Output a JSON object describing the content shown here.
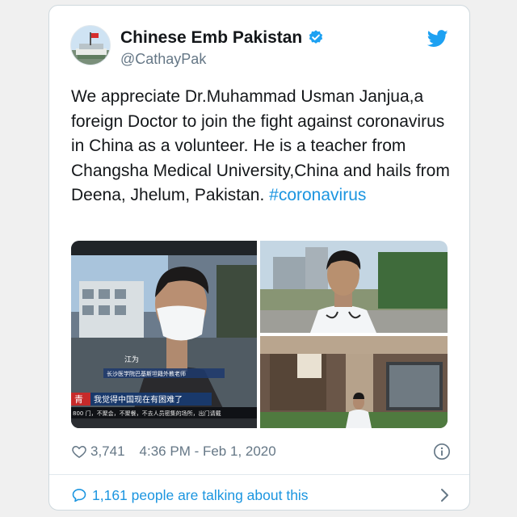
{
  "tweet": {
    "display_name": "Chinese Emb Pakistan",
    "handle": "@CathayPak",
    "text_main": "We appreciate Dr.Muhammad Usman Janjua,a foreign Doctor to join the fight against coronavirus in China as a volunteer. He is a teacher from Changsha Medical University,China and hails from Deena, Jhelum, Pakistan.",
    "hashtag": "#coronavirus",
    "likes": "3,741",
    "time": "4:36 PM",
    "date_sep": " - ",
    "date": "Feb 1, 2020",
    "conversation": "1,161 people are talking about this"
  },
  "media": {
    "tv_caption_name": "江为",
    "tv_caption_title": "长沙医学院巴基斯坦籍外教老师",
    "tv_ticker_prefix": "青",
    "tv_ticker_main": "我觉得中国现在有困难了",
    "tv_bottom_text": "800 门，不聚会，不聚餐，不去人员密集的场所，出门请戴"
  },
  "colors": {
    "link": "#1b95e0",
    "verified": "#1da1f2",
    "secondary_text": "#657786"
  },
  "icons": [
    "verified-badge-icon",
    "twitter-bird-icon",
    "heart-icon",
    "info-icon",
    "speech-bubble-icon",
    "chevron-right-icon"
  ]
}
